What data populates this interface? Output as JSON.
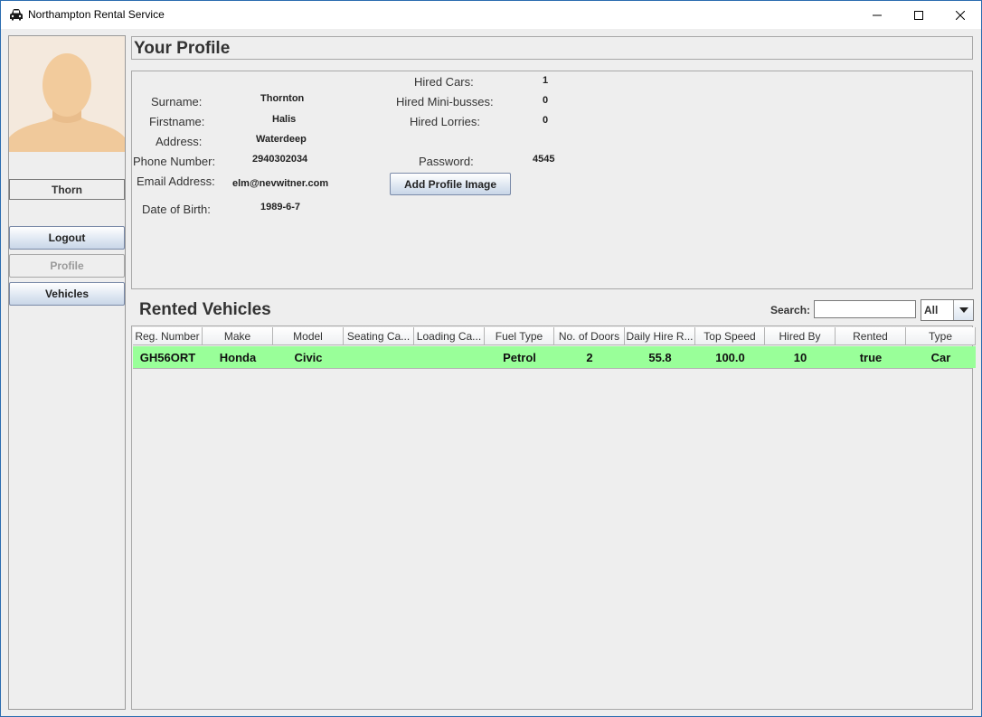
{
  "window": {
    "title": "Northampton Rental Service",
    "controls": {
      "minimize": "minimize",
      "maximize": "maximize",
      "close": "close"
    }
  },
  "sidebar": {
    "username": "Thorn",
    "buttons": {
      "logout": "Logout",
      "profile": "Profile",
      "vehicles": "Vehicles"
    }
  },
  "profile": {
    "heading": "Your Profile",
    "fields": {
      "surname": {
        "label": "Surname:",
        "value": "Thornton"
      },
      "firstname": {
        "label": "Firstname:",
        "value": "Halis"
      },
      "address": {
        "label": "Address:",
        "value": "Waterdeep"
      },
      "phone": {
        "label": "Phone Number:",
        "value": "2940302034"
      },
      "email": {
        "label": "Email Address:",
        "value": "elm@nevwitner.com"
      },
      "dob": {
        "label": "Date of Birth:",
        "value": "1989-6-7"
      },
      "hired_cars": {
        "label": "Hired Cars:",
        "value": "1"
      },
      "hired_minibusses": {
        "label": "Hired Mini-busses:",
        "value": "0"
      },
      "hired_lorries": {
        "label": "Hired Lorries:",
        "value": "0"
      },
      "password": {
        "label": "Password:",
        "value": "4545"
      }
    },
    "add_image_button": "Add Profile Image"
  },
  "rented": {
    "heading": "Rented Vehicles",
    "search_label": "Search:",
    "search_value": "",
    "filter_selected": "All",
    "columns": [
      "Reg. Number",
      "Make",
      "Model",
      "Seating Ca...",
      "Loading Ca...",
      "Fuel Type",
      "No. of Doors",
      "Daily Hire R...",
      "Top Speed",
      "Hired By",
      "Rented",
      "Type"
    ],
    "rows": [
      [
        "GH56ORT",
        "Honda",
        "Civic",
        "",
        "",
        "Petrol",
        "2",
        "55.8",
        "100.0",
        "10",
        "true",
        "Car"
      ]
    ],
    "row_color": "#99ff99"
  },
  "colors": {
    "accent": "#2b6cb0",
    "highlight_row": "#99ff99",
    "background": "#eeeeee"
  }
}
